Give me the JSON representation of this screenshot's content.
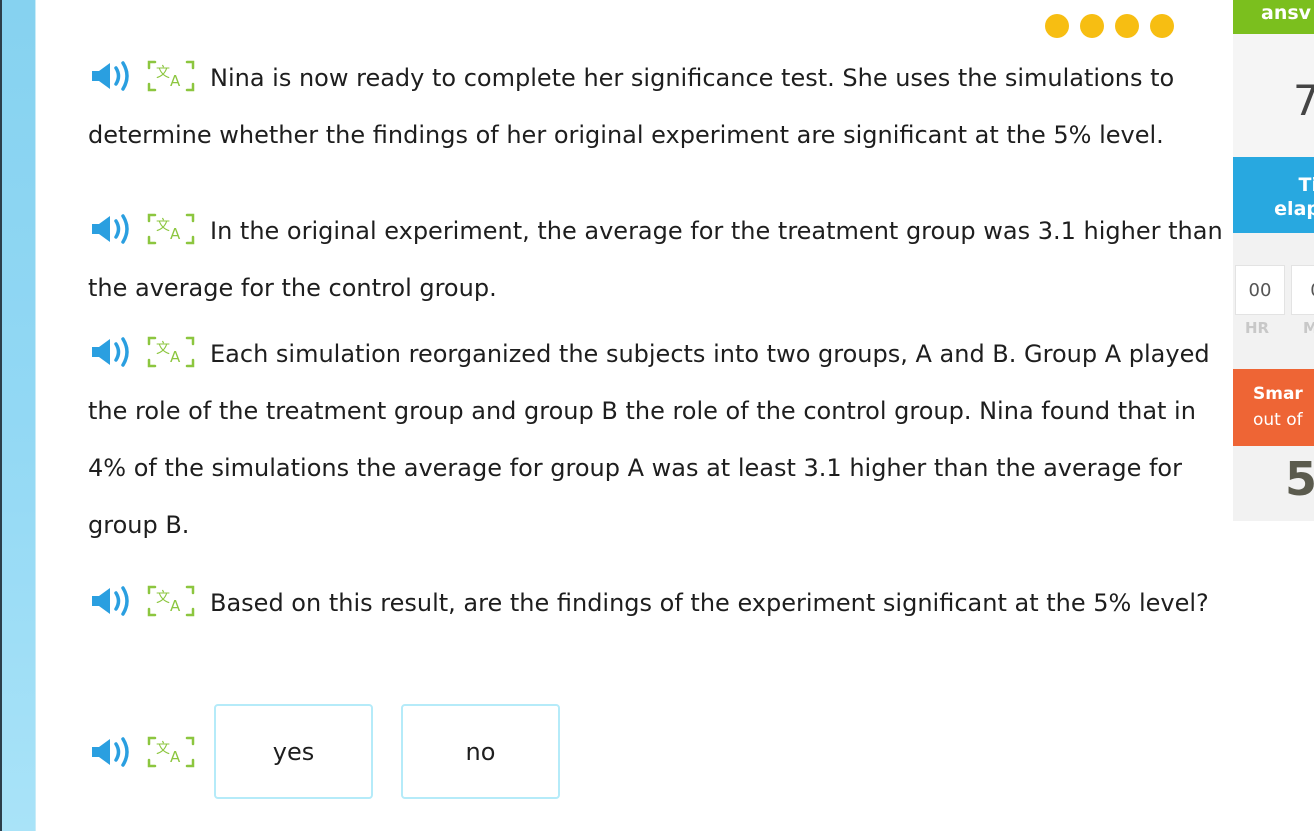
{
  "progress": {
    "dots_count": 4,
    "dot_color": "#f7be12"
  },
  "question": {
    "paragraphs": [
      {
        "text": "Nina is now ready to complete her significance test. She uses the simulations to determine whether the findings of her original experiment are significant at the 5% level."
      },
      {
        "text": "In the original experiment, the average for the treatment group was 3.1 higher than the average for the control group."
      },
      {
        "text": "Each simulation reorganized the subjects into two groups, A and B. Group A played the role of the treatment group and group B the role of the control group. Nina found that in 4% of the simulations the average for group A was at least 3.1 higher than the average for group B."
      },
      {
        "text": "Based on this result, are the findings of the experiment significant at the 5% level?"
      }
    ],
    "icons": {
      "audio": "speaker-icon",
      "translate": "translate-icon"
    },
    "choices": [
      {
        "label": "yes"
      },
      {
        "label": "no"
      }
    ]
  },
  "sidebar": {
    "answered": {
      "label": "answered",
      "visible_label": "ansv",
      "value": "7"
    },
    "time": {
      "label_line1": "Ti",
      "label_line2": "elap",
      "hours": "00",
      "minutes": "0",
      "hr_label": "HR",
      "min_label": "M"
    },
    "smartscore": {
      "title": "Smar",
      "subtitle": "out of",
      "value": "5"
    }
  },
  "colors": {
    "answered_green": "#7bbf1e",
    "time_blue": "#28a8e0",
    "smart_orange": "#ee6535",
    "audio_blue": "#2a9fe0",
    "translate_green": "#8cc63f",
    "choice_border": "#b5ebf9"
  }
}
